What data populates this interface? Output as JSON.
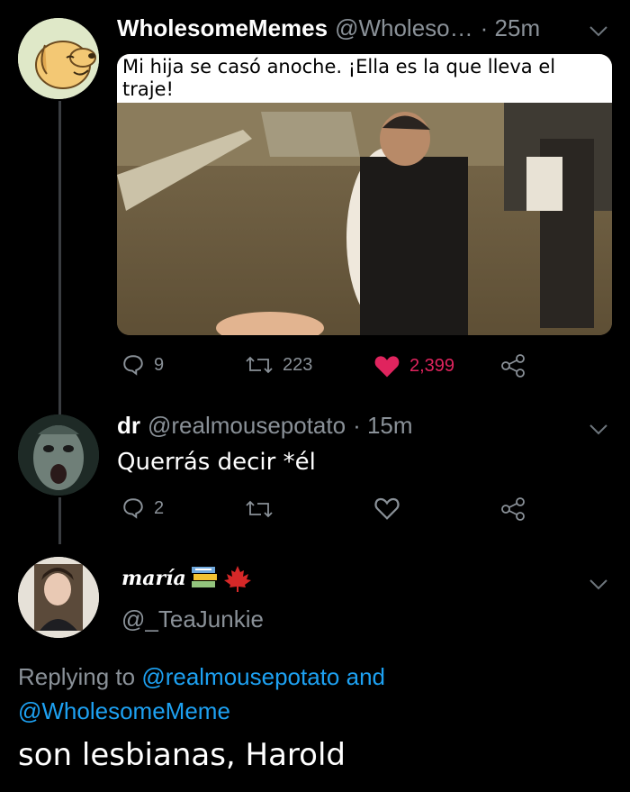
{
  "tweets": [
    {
      "name": "WholesomeMemes",
      "handle": "@Wholeso…",
      "time": "· 25m",
      "media_caption": "Mi hija se casó anoche. ¡Ella es la que lleva el traje!",
      "metrics": {
        "replies": "9",
        "retweets": "223",
        "likes": "2,399"
      }
    },
    {
      "name": "dr",
      "handle": "@realmousepotato",
      "time": "· 15m",
      "text": "Querrás decir *él",
      "metrics": {
        "replies": "2"
      }
    },
    {
      "name": "maría",
      "handle": "@_TeaJunkie",
      "replying_prefix": "Replying to",
      "replying_user1": "@realmousepotato",
      "replying_and": "and",
      "replying_user2": "@WholesomeMeme",
      "text": "son lesbianas, Harold"
    }
  ],
  "colors": {
    "background": "#000000",
    "link": "#1da1f2",
    "like": "#e0245e",
    "muted": "#8a9198"
  }
}
